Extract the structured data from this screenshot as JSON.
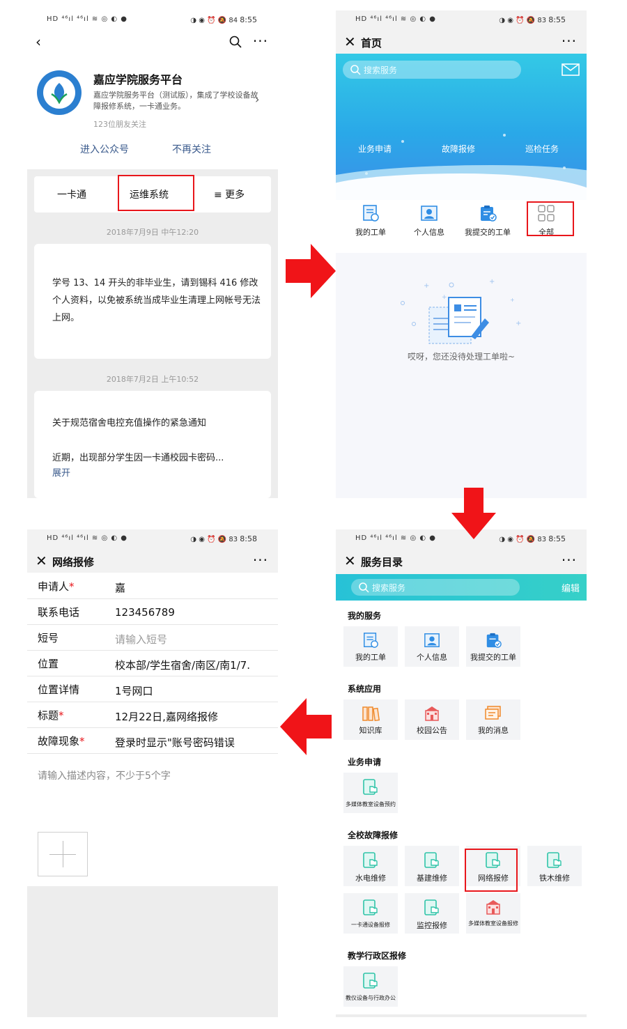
{
  "status_bar": {
    "left": "HD ⁴⁶ıl ⁴⁶ıl ≋ ◎ ◐ ●",
    "right_icons": "◑ ◉ ⏰ 🔕",
    "battery": "84",
    "battery2": "83",
    "time1": "8:55",
    "time2": "8:58"
  },
  "panel1": {
    "account_name": "嘉应学院服务平台",
    "account_desc": "嘉应学院服务平台（测试版），集成了学校设备故障报修系统，一卡通业务。",
    "followers": "123位朋友关注",
    "enter_label": "进入公众号",
    "unfollow_label": "不再关注",
    "menu": [
      "一卡通",
      "运维系统",
      "≡  更多"
    ],
    "time1": "2018年7月9日 中午12:20",
    "card1_text": "学号 13、14 开头的非毕业生，请到锡科 416 修改个人资料，以免被系统当成毕业生清理上网帐号无法上网。",
    "time2": "2018年7月2日 上午10:52",
    "card2_title": "关于规范宿舍电控充值操作的紧急通知",
    "card2_body": "近期，出现部分学生因一卡通校园卡密码...",
    "card2_more": "展开"
  },
  "panel2": {
    "title": "首页",
    "search_placeholder": "搜索服务",
    "banner_links": [
      "业务申请",
      "故障报修",
      "巡检任务"
    ],
    "quick": [
      "我的工单",
      "个人信息",
      "我提交的工单",
      "全部"
    ],
    "empty_text": "哎呀，您还没待处理工单啦~"
  },
  "panel3": {
    "title": "网络报修",
    "rows": [
      {
        "label": "申请人",
        "required": "*",
        "value": "嘉"
      },
      {
        "label": "联系电话",
        "required": "",
        "value": "123456789"
      },
      {
        "label": "短号",
        "required": "",
        "value": "请输入短号"
      },
      {
        "label": "位置",
        "required": "",
        "value": "校本部/学生宿舍/南区/南1/7."
      },
      {
        "label": "位置详情",
        "required": "",
        "value": "1号网口"
      },
      {
        "label": "标题",
        "required": "*",
        "value": "12月22日,嘉网络报修"
      },
      {
        "label": "故障现象",
        "required": "*",
        "value": "登录时显示\"账号密码错误"
      }
    ],
    "desc_placeholder": "请输入描述内容，不少于5个字"
  },
  "panel4": {
    "title": "服务目录",
    "search_placeholder": "搜索服务",
    "edit_label": "编辑",
    "sections": [
      {
        "title": "我的服务",
        "items": [
          "我的工单",
          "个人信息",
          "我提交的工单"
        ]
      },
      {
        "title": "系统应用",
        "items": [
          "知识库",
          "校园公告",
          "我的消息"
        ]
      },
      {
        "title": "业务申请",
        "items": [
          "多媒体教室设备预约"
        ]
      },
      {
        "title": "全校故障报修",
        "items": [
          "水电维修",
          "基建维修",
          "网络报修",
          "铁木维修",
          "一卡通设备报修",
          "监控报修",
          "多媒体教室设备报修"
        ]
      },
      {
        "title": "教学行政区报修",
        "items": [
          "教仪设备与行政办公"
        ]
      }
    ]
  },
  "colors": {
    "highlight": "#e8161b",
    "teal": "#2fc4c4",
    "link": "#3a5a8c",
    "icon_blue": "#2f8de4"
  }
}
